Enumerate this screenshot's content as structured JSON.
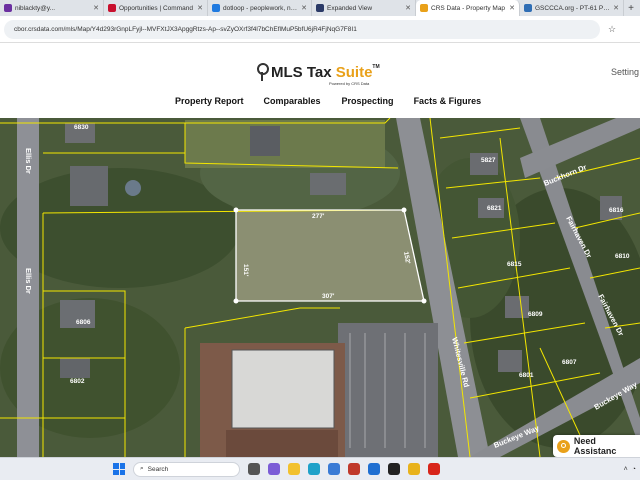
{
  "browser": {
    "tabs": [
      {
        "title": "niblackty@y...",
        "color": "#6b2fa0"
      },
      {
        "title": "Opportunities | Command",
        "color": "#c8102e"
      },
      {
        "title": "dotloop - peoplework, no...",
        "color": "#1f7ae0"
      },
      {
        "title": "Expanded View",
        "color": "#2b3a67"
      },
      {
        "title": "CRS Data - Property Map",
        "color": "#e9a11a"
      },
      {
        "title": "GSCCCA.org - PT-61 Prem...",
        "color": "#2e6db4"
      }
    ],
    "new_tab_label": "+",
    "url": "cbor.crsdata.com/mls/Map/Y4d293rGnpLFyjl--MVFXtJX3ApggRtzs-Ap--svZyOXrf3f4l7bChEflMuP5bfU6jR4FjNqG7F8I1"
  },
  "site": {
    "logo": {
      "name": "MLS Tax ",
      "accent": "Suite",
      "tm": "TM",
      "powered": "Powered by CRS Data"
    },
    "settings_label": "Setting",
    "nav": [
      "Property Report",
      "Comparables",
      "Prospecting",
      "Facts & Figures"
    ]
  },
  "map": {
    "parcel_dims": {
      "top": "277'",
      "bottom": "307'",
      "left": "151'",
      "right": "152'"
    },
    "lot_numbers": [
      "6830",
      "6806",
      "6802",
      "5827",
      "6821",
      "6815",
      "6809",
      "6801",
      "6816",
      "6810",
      "6807"
    ],
    "streets": [
      "Ellis Dr",
      "Whitesville Rd",
      "Buckhorn Dr",
      "Fairhaven Dr",
      "Buckeye Way",
      "Buckeye Way"
    ]
  },
  "assistant_label": "Need Assistanc",
  "taskbar": {
    "search_placeholder": "Search"
  }
}
